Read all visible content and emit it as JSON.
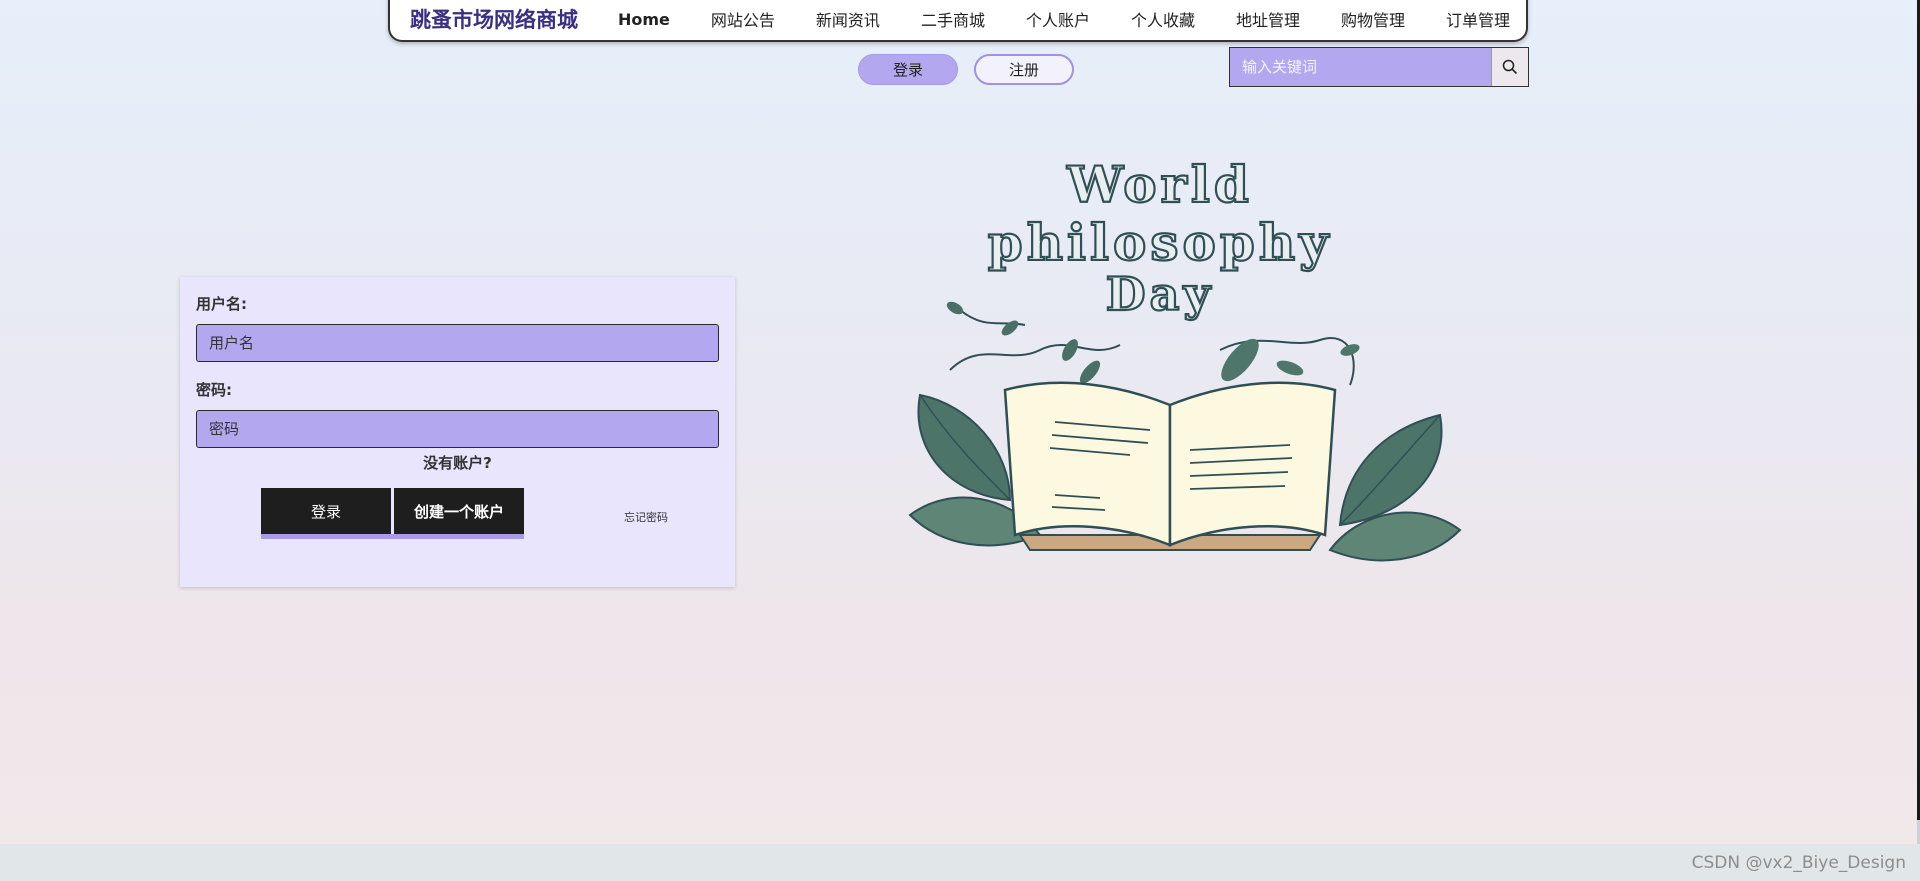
{
  "nav": {
    "brand": "跳蚤市场网络商城",
    "items": [
      "Home",
      "网站公告",
      "新闻资讯",
      "二手商城",
      "个人账户",
      "个人收藏",
      "地址管理",
      "购物管理",
      "订单管理"
    ]
  },
  "auth": {
    "login_label": "登录",
    "register_label": "注册"
  },
  "search": {
    "placeholder": "输入关键词",
    "icon": "search-icon"
  },
  "form": {
    "username_label": "用户名:",
    "username_placeholder": "用户名",
    "password_label": "密码:",
    "password_placeholder": "密码",
    "no_account": "没有账户?",
    "login_button": "登录",
    "create_button": "创建一个账户",
    "forgot_password": "忘记密码"
  },
  "illustration": {
    "title_lines": [
      "World",
      "philosophy",
      "Day"
    ],
    "icon": "open-book-illustration"
  },
  "watermark": "CSDN @vx2_Biye_Design",
  "colors": {
    "accent": "#b3a7ef",
    "brand": "#3a2f82",
    "card": "#e8e5fc",
    "button_dark": "#1e1e1e"
  }
}
